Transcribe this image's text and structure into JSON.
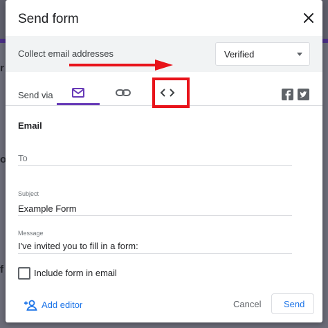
{
  "dialog": {
    "title": "Send form",
    "close_icon": "close-icon"
  },
  "collect": {
    "label": "Collect email addresses",
    "selected": "Verified"
  },
  "send_via": {
    "label": "Send via",
    "tabs": [
      {
        "icon": "mail-icon",
        "active": true
      },
      {
        "icon": "link-icon",
        "active": false
      },
      {
        "icon": "embed-code-icon",
        "active": false
      }
    ],
    "share": [
      {
        "icon": "facebook-icon"
      },
      {
        "icon": "twitter-icon"
      }
    ]
  },
  "email_form": {
    "section_title": "Email",
    "to_placeholder": "To",
    "subject_label": "Subject",
    "subject_value": "Example Form",
    "message_label": "Message",
    "message_value": "I've invited you to fill in a form:",
    "include_label": "Include form in email",
    "include_checked": false
  },
  "footer": {
    "add_editor_label": "Add editor",
    "cancel_label": "Cancel",
    "send_label": "Send"
  },
  "colors": {
    "accent": "#673ab7",
    "link_blue": "#1a73e8",
    "annotation_red": "#e8131a"
  }
}
